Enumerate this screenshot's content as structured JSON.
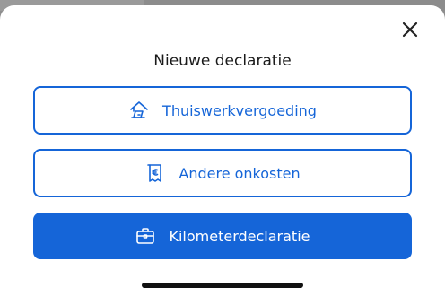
{
  "modal": {
    "title": "Nieuwe declaratie",
    "close_icon": "close-icon"
  },
  "options": [
    {
      "label": "Thuiswerkvergoeding",
      "icon": "home-work-icon",
      "style": "outline"
    },
    {
      "label": "Andere onkosten",
      "icon": "receipt-euro-icon",
      "style": "outline"
    },
    {
      "label": "Kilometerdeclaratie",
      "icon": "briefcase-icon",
      "style": "filled"
    }
  ],
  "colors": {
    "accent": "#1565d8",
    "sheet_background": "#ffffff",
    "backdrop": "#8e8e8e",
    "title_text": "#1a1a1a"
  }
}
